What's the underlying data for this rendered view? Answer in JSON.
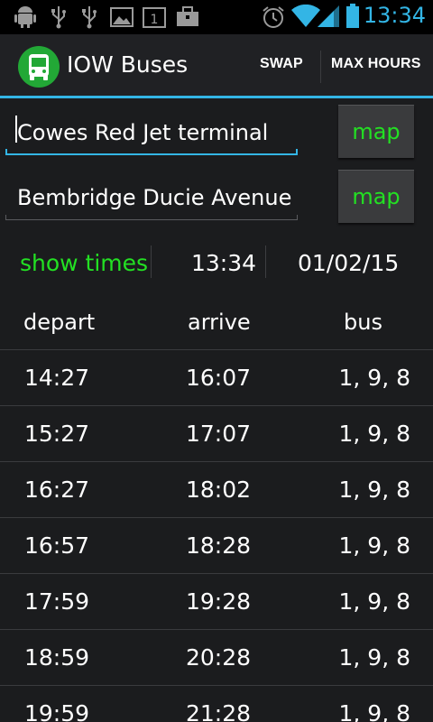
{
  "status_bar": {
    "time": "13:34",
    "notification_badge": "1",
    "icons": [
      "android-debug-icon",
      "usb-icon",
      "usb-icon",
      "image-icon",
      "calendar-icon",
      "briefcase-icon",
      "alarm-icon",
      "wifi-icon",
      "signal-icon",
      "battery-icon"
    ],
    "accent_color": "#33b5e5"
  },
  "action_bar": {
    "title": "IOW Buses",
    "app_icon": "bus-icon",
    "swap_label": "SWAP",
    "max_hours_label": "MAX HOURS"
  },
  "route": {
    "from": "Cowes Red Jet terminal",
    "to": "Bembridge Ducie Avenue",
    "map_label": "map"
  },
  "controls": {
    "show_times_label": "show times",
    "time": "13:34",
    "date": "01/02/15",
    "accent_green": "#23e023"
  },
  "table": {
    "headers": {
      "depart": "depart",
      "arrive": "arrive",
      "bus": "bus"
    },
    "rows": [
      {
        "depart": "14:27",
        "arrive": "16:07",
        "bus": "1, 9, 8"
      },
      {
        "depart": "15:27",
        "arrive": "17:07",
        "bus": "1, 9, 8"
      },
      {
        "depart": "16:27",
        "arrive": "18:02",
        "bus": "1, 9, 8"
      },
      {
        "depart": "16:57",
        "arrive": "18:28",
        "bus": "1, 9, 8"
      },
      {
        "depart": "17:59",
        "arrive": "19:28",
        "bus": "1, 9, 8"
      },
      {
        "depart": "18:59",
        "arrive": "20:28",
        "bus": "1, 9, 8"
      },
      {
        "depart": "19:59",
        "arrive": "21:28",
        "bus": "1, 9, 8"
      }
    ]
  }
}
